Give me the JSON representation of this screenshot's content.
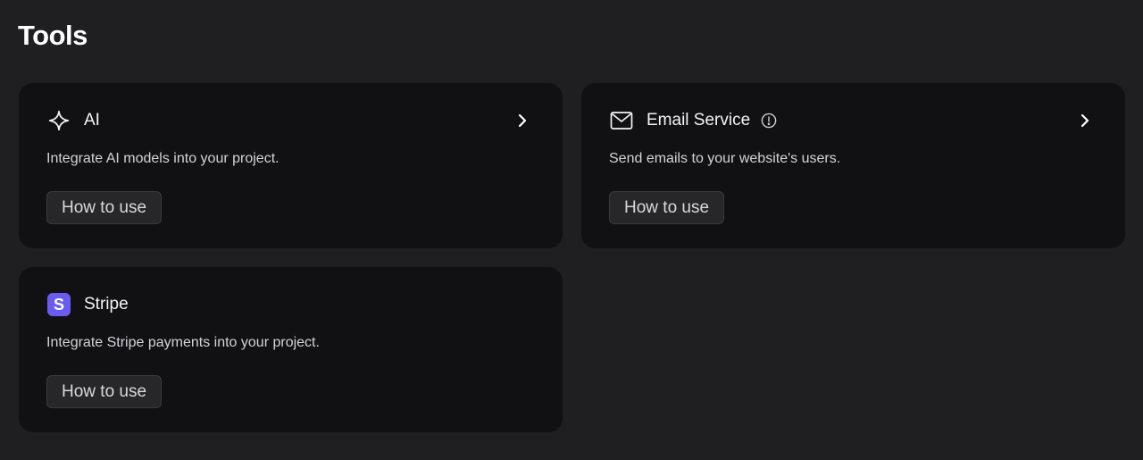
{
  "page": {
    "title": "Tools"
  },
  "tools": [
    {
      "name": "AI",
      "icon": "sparkle-icon",
      "description": "Integrate AI models into your project.",
      "button_label": "How to use",
      "has_arrow": true,
      "has_info": false
    },
    {
      "name": "Email Service",
      "icon": "mail-icon",
      "description": "Send emails to your website's users.",
      "button_label": "How to use",
      "has_arrow": true,
      "has_info": true
    },
    {
      "name": "Stripe",
      "icon": "stripe-logo-icon",
      "icon_letter": "S",
      "icon_color": "#6a5cf0",
      "description": "Integrate Stripe payments into your project.",
      "button_label": "How to use",
      "has_arrow": false,
      "has_info": false
    }
  ],
  "colors": {
    "background": "#1f1f21",
    "card": "#111113",
    "button": "#27272a",
    "stripe_brand": "#6a5cf0"
  }
}
